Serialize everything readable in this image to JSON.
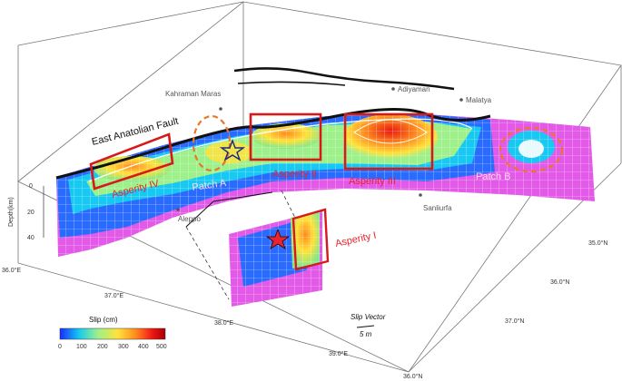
{
  "fault_name": "East Anatolian Fault",
  "cities": [
    {
      "name": "Kahraman Maras"
    },
    {
      "name": "Adiyaman"
    },
    {
      "name": "Malatya"
    },
    {
      "name": "Sanliurfa"
    },
    {
      "name": "Aleppo"
    }
  ],
  "asperities": [
    {
      "label": "Asperity IV"
    },
    {
      "label": "Asperity II"
    },
    {
      "label": "Asperity III"
    },
    {
      "label": "Asperity I"
    }
  ],
  "patches": [
    {
      "label": "Patch A"
    },
    {
      "label": "Patch B"
    }
  ],
  "depth_axis": {
    "label": "Depth(km)",
    "ticks": [
      "0",
      "20",
      "40"
    ]
  },
  "longitude_ticks": [
    "36.0°E",
    "37.0°E",
    "38.0°E",
    "39.0°E"
  ],
  "latitude_ticks": [
    "35.0°N",
    "36.0°N",
    "37.0°N"
  ],
  "latitude_bottom": "36.0°N",
  "colorbar": {
    "title": "Slip (cm)",
    "ticks": [
      "0",
      "100",
      "200",
      "300",
      "400",
      "500"
    ],
    "colors": [
      "#1a2bff",
      "#16c8f2",
      "#9ef08a",
      "#ffe23a",
      "#ff8a1e",
      "#f01414",
      "#a00000"
    ]
  },
  "slip_vector": {
    "title": "Slip Vector",
    "scale_label": "5 m"
  }
}
